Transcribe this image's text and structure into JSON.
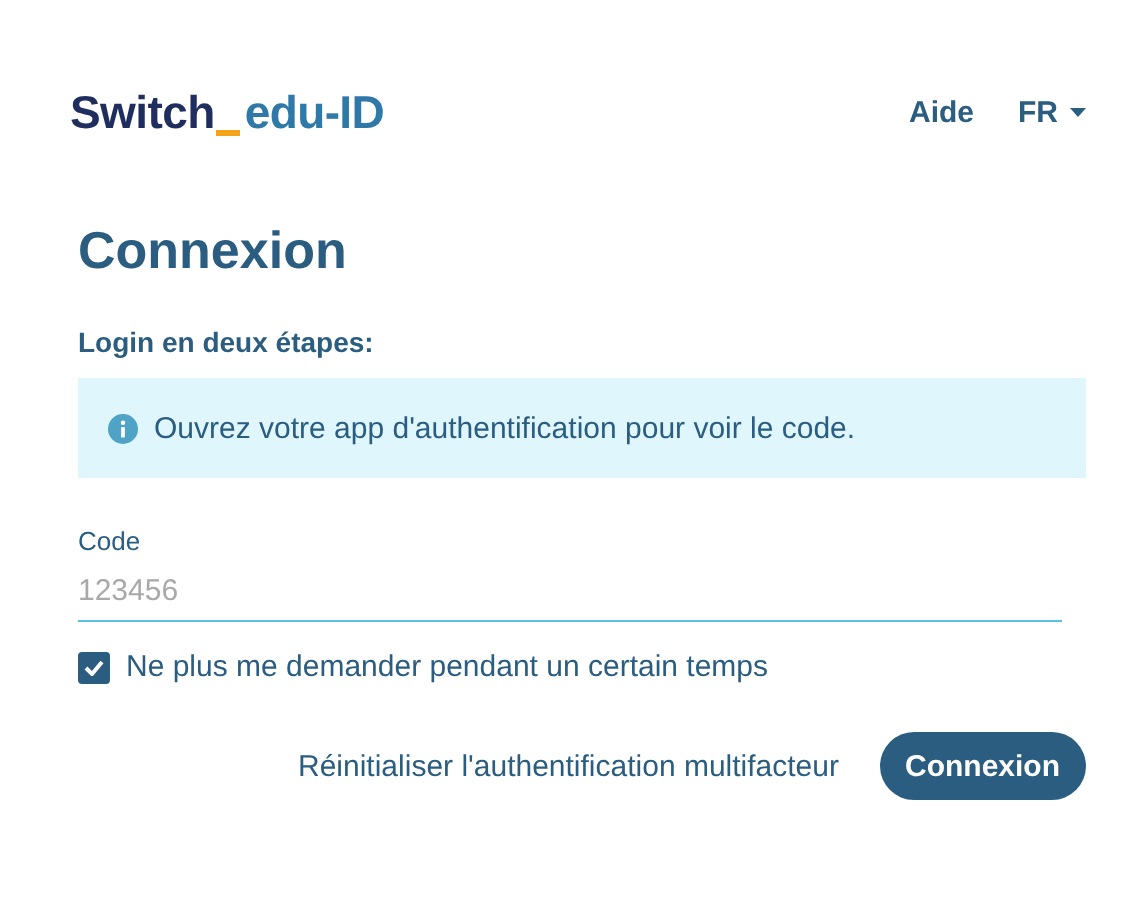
{
  "header": {
    "logo": {
      "part_1": "Switch",
      "part_2": "edu-ID"
    },
    "nav": [
      {
        "label": "Aide",
        "kind": "link"
      },
      {
        "label": "FR",
        "kind": "dropdown"
      }
    ]
  },
  "title": "Connexion",
  "section_label": "Login en deux étapes:",
  "info": "Ouvrez votre app d'authentification pour voir le code.",
  "code_field": {
    "label": "Code",
    "placeholder": "123456"
  },
  "remember": {
    "label": "Ne plus me demander pendant un certain temps",
    "checked": true
  },
  "actions": {
    "reset_link": "Réinitialiser l'authentification multifacteur",
    "submit": "Connexion"
  }
}
